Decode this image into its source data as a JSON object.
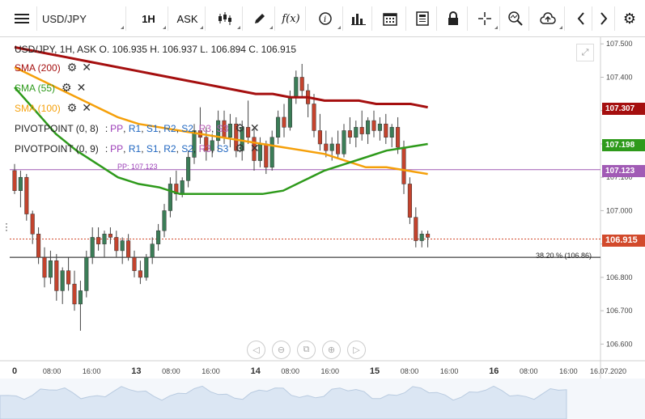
{
  "toolbar": {
    "menu_icon": "hamburger-menu-icon",
    "symbol": "USD/JPY",
    "timeframe": "1H",
    "price_type": "ASK",
    "icons": [
      "candlestick-chart-icon",
      "pencil-draw-icon",
      "function-fx-icon",
      "info-icon",
      "indicator-bars-icon",
      "calendar-icon",
      "news-document-icon",
      "lock-icon",
      "crosshair-icon",
      "zoom-icon",
      "cloud-upload-icon",
      "chevron-left-icon",
      "chevron-right-icon",
      "gear-icon"
    ]
  },
  "legend": {
    "ohlc": "USD/JPY, 1H, ASK   O. 106.935 H. 106.937 L. 106.894 C. 106.915",
    "indicators": [
      {
        "label": "SMA (200)",
        "color": "#a50f0f"
      },
      {
        "label": "SMA (55)",
        "color": "#2e9a1b"
      },
      {
        "label": "SMA (100)",
        "color": "#f5a00a"
      }
    ],
    "pivots": [
      {
        "name": "PIVOTPOINT (0, 8)",
        "items": [
          "PP",
          "R1",
          "S1",
          "R2",
          "S2",
          "R3",
          "S3"
        ]
      },
      {
        "name": "PIVOTPOINT (0, 9)",
        "items": [
          "PP",
          "R1",
          "S1",
          "R2",
          "S2",
          "R3",
          "S3"
        ]
      }
    ],
    "pp_label": "PP: 107.123",
    "fib_label": "38.20 % (106.86)"
  },
  "price_tags": [
    {
      "value": "107.307",
      "color": "#a50f0f"
    },
    {
      "value": "107.198",
      "color": "#2e9a1b"
    },
    {
      "value": "107.123",
      "color": "#a15bb5"
    },
    {
      "value": "106.915",
      "color": "#d24a2c"
    }
  ],
  "chart_data": {
    "type": "candlestick",
    "ylim": [
      106.55,
      107.52
    ],
    "y_ticks": [
      "107.500",
      "107.400",
      "107.300",
      "107.200",
      "107.100",
      "107.000",
      "106.900",
      "106.800",
      "106.700",
      "106.600"
    ],
    "x_ticks": [
      {
        "label": "0",
        "day": true
      },
      {
        "label": "08:00",
        "day": false
      },
      {
        "label": "16:00",
        "day": false
      },
      {
        "label": "13",
        "day": true
      },
      {
        "label": "08:00",
        "day": false
      },
      {
        "label": "16:00",
        "day": false
      },
      {
        "label": "14",
        "day": true
      },
      {
        "label": "08:00",
        "day": false
      },
      {
        "label": "16:00",
        "day": false
      },
      {
        "label": "15",
        "day": true
      },
      {
        "label": "08:00",
        "day": false
      },
      {
        "label": "16:00",
        "day": false
      },
      {
        "label": "16",
        "day": true
      },
      {
        "label": "08:00",
        "day": false
      },
      {
        "label": "16:00",
        "day": false
      },
      {
        "label": "16.07.2020",
        "day": false
      }
    ],
    "candles": [
      [
        107.12,
        107.14,
        107.05,
        107.06
      ],
      [
        107.06,
        107.12,
        107.01,
        107.1
      ],
      [
        107.1,
        107.11,
        106.97,
        106.99
      ],
      [
        106.99,
        107.0,
        106.9,
        106.93
      ],
      [
        106.93,
        106.95,
        106.84,
        106.86
      ],
      [
        106.86,
        106.89,
        106.77,
        106.8
      ],
      [
        106.8,
        106.88,
        106.78,
        106.85
      ],
      [
        106.85,
        106.87,
        106.73,
        106.76
      ],
      [
        106.76,
        106.83,
        106.72,
        106.82
      ],
      [
        106.82,
        106.86,
        106.76,
        106.78
      ],
      [
        106.78,
        106.82,
        106.7,
        106.72
      ],
      [
        106.72,
        106.79,
        106.64,
        106.76
      ],
      [
        106.76,
        106.88,
        106.74,
        106.86
      ],
      [
        106.86,
        106.95,
        106.84,
        106.92
      ],
      [
        106.92,
        106.95,
        106.88,
        106.9
      ],
      [
        106.9,
        106.94,
        106.86,
        106.93
      ],
      [
        106.93,
        106.95,
        106.9,
        106.92
      ],
      [
        106.92,
        106.94,
        106.86,
        106.88
      ],
      [
        106.88,
        106.92,
        106.84,
        106.91
      ],
      [
        106.91,
        106.93,
        106.85,
        106.86
      ],
      [
        106.86,
        106.88,
        106.8,
        106.82
      ],
      [
        106.82,
        106.85,
        106.78,
        106.8
      ],
      [
        106.8,
        106.87,
        106.79,
        106.86
      ],
      [
        106.86,
        106.92,
        106.84,
        106.9
      ],
      [
        106.9,
        106.96,
        106.88,
        106.94
      ],
      [
        106.94,
        107.02,
        106.92,
        107.0
      ],
      [
        107.0,
        107.1,
        106.98,
        107.08
      ],
      [
        107.08,
        107.12,
        107.03,
        107.05
      ],
      [
        107.05,
        107.1,
        107.04,
        107.09
      ],
      [
        107.09,
        107.18,
        107.07,
        107.16
      ],
      [
        107.16,
        107.26,
        107.14,
        107.24
      ],
      [
        107.24,
        107.31,
        107.2,
        107.22
      ],
      [
        107.22,
        107.25,
        107.15,
        107.18
      ],
      [
        107.18,
        107.23,
        107.16,
        107.21
      ],
      [
        107.21,
        107.3,
        107.18,
        107.27
      ],
      [
        107.27,
        107.3,
        107.2,
        107.22
      ],
      [
        107.22,
        107.29,
        107.19,
        107.26
      ],
      [
        107.26,
        107.28,
        107.16,
        107.18
      ],
      [
        107.18,
        107.27,
        107.15,
        107.25
      ],
      [
        107.25,
        107.33,
        107.2,
        107.22
      ],
      [
        107.22,
        107.25,
        107.12,
        107.15
      ],
      [
        107.15,
        107.22,
        107.13,
        107.2
      ],
      [
        107.2,
        107.21,
        107.11,
        107.13
      ],
      [
        107.13,
        107.24,
        107.12,
        107.22
      ],
      [
        107.22,
        107.3,
        107.2,
        107.28
      ],
      [
        107.28,
        107.32,
        107.22,
        107.25
      ],
      [
        107.25,
        107.36,
        107.24,
        107.34
      ],
      [
        107.34,
        107.42,
        107.32,
        107.4
      ],
      [
        107.4,
        107.44,
        107.34,
        107.36
      ],
      [
        107.36,
        107.38,
        107.28,
        107.32
      ],
      [
        107.32,
        107.35,
        107.22,
        107.24
      ],
      [
        107.24,
        107.29,
        107.18,
        107.2
      ],
      [
        107.2,
        107.24,
        107.16,
        107.18
      ],
      [
        107.18,
        107.22,
        107.15,
        107.2
      ],
      [
        107.2,
        107.24,
        107.16,
        107.17
      ],
      [
        107.17,
        107.26,
        107.16,
        107.24
      ],
      [
        107.24,
        107.28,
        107.2,
        107.22
      ],
      [
        107.22,
        107.27,
        107.19,
        107.25
      ],
      [
        107.25,
        107.3,
        107.21,
        107.23
      ],
      [
        107.23,
        107.28,
        107.2,
        107.27
      ],
      [
        107.27,
        107.3,
        107.22,
        107.24
      ],
      [
        107.24,
        107.28,
        107.21,
        107.26
      ],
      [
        107.26,
        107.29,
        107.2,
        107.22
      ],
      [
        107.22,
        107.26,
        107.19,
        107.25
      ],
      [
        107.25,
        107.28,
        107.17,
        107.19
      ],
      [
        107.19,
        107.21,
        107.05,
        107.08
      ],
      [
        107.08,
        107.1,
        106.96,
        106.98
      ],
      [
        106.98,
        107.01,
        106.89,
        106.91
      ],
      [
        106.91,
        106.94,
        106.89,
        106.93
      ],
      [
        106.93,
        106.94,
        106.89,
        106.92
      ]
    ],
    "sma200": [
      107.49,
      107.48,
      107.47,
      107.46,
      107.45,
      107.44,
      107.43,
      107.42,
      107.41,
      107.4,
      107.39,
      107.38,
      107.37,
      107.36,
      107.35,
      107.35,
      107.34,
      107.34,
      107.33,
      107.33,
      107.33,
      107.32,
      107.32,
      107.32,
      107.31
    ],
    "sma55": [
      107.37,
      107.3,
      107.23,
      107.18,
      107.14,
      107.1,
      107.08,
      107.07,
      107.05,
      107.05,
      107.05,
      107.05,
      107.05,
      107.06,
      107.09,
      107.12,
      107.14,
      107.16,
      107.18,
      107.19,
      107.2
    ],
    "sma100": [
      107.43,
      107.4,
      107.37,
      107.34,
      107.31,
      107.28,
      107.26,
      107.25,
      107.24,
      107.23,
      107.22,
      107.21,
      107.2,
      107.19,
      107.18,
      107.17,
      107.15,
      107.13,
      107.13,
      107.12,
      107.11
    ],
    "pivot_level": 107.123,
    "current_level": 106.915,
    "fib_level": 106.86
  },
  "nav_icons": [
    "scroll-left-icon",
    "zoom-out-icon",
    "reset-view-icon",
    "zoom-in-icon",
    "scroll-right-icon"
  ]
}
